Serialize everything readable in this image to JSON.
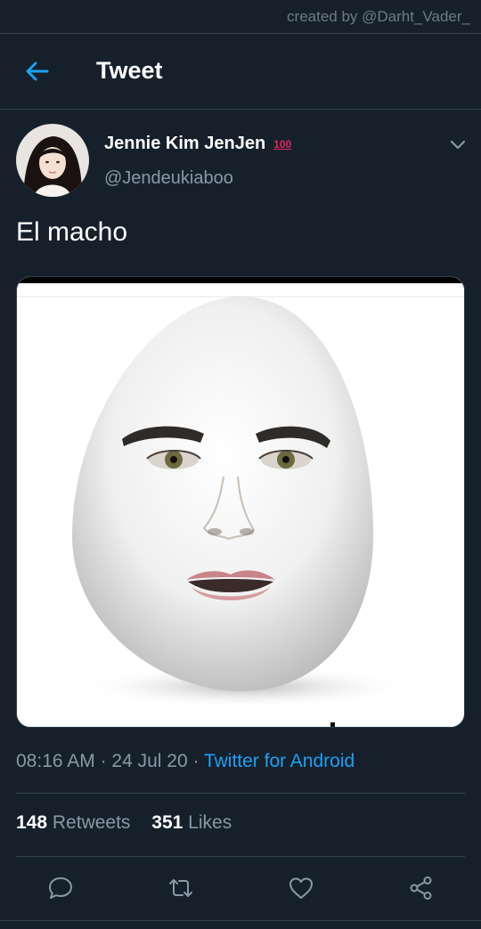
{
  "watermark": "created by @Darht_Vader_",
  "header": {
    "title": "Tweet",
    "back_icon": "arrow-left-icon"
  },
  "tweet": {
    "author_name": "Jennie Kim JenJen",
    "badge": "100",
    "handle": "@Jendeukiaboo",
    "text": "El macho",
    "time": "08:16 AM",
    "date": "24 Jul 20",
    "separator": " · ",
    "source": "Twitter for Android",
    "retweets_count": "148",
    "retweets_label": "Retweets",
    "likes_count": "351",
    "likes_label": "Likes"
  },
  "actions": [
    "reply-icon",
    "retweet-icon",
    "like-icon",
    "share-icon"
  ],
  "colors": {
    "background": "#15202b",
    "accent": "#1da1f2",
    "secondary_text": "#8899a6",
    "divider": "#38444d",
    "badge": "#e0245e"
  }
}
